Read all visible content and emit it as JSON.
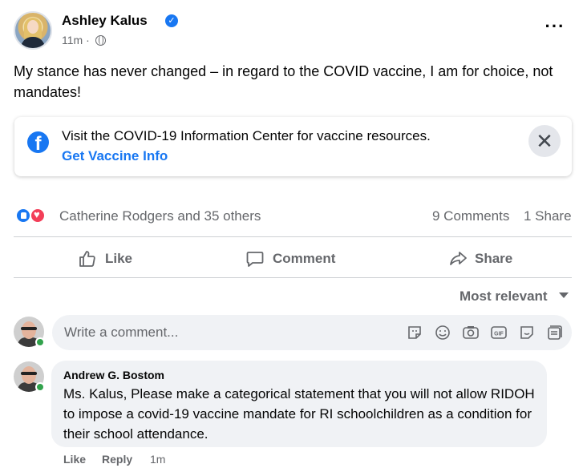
{
  "post": {
    "author": "Ashley Kalus",
    "time": "11m ·",
    "text": "My stance has never changed – in regard to the COVID vaccine, I am for choice, not mandates!"
  },
  "info_card": {
    "text": "Visit the COVID-19 Information Center for vaccine resources.",
    "link": "Get Vaccine Info",
    "close_symbol": "✕"
  },
  "stats": {
    "reactions": "Catherine Rodgers and 35 others",
    "comments": "9 Comments",
    "shares": "1 Share"
  },
  "actions": {
    "like": "Like",
    "comment": "Comment",
    "share": "Share"
  },
  "comments_sort": "Most relevant",
  "comment_input": {
    "placeholder": "Write a comment..."
  },
  "comment": {
    "author": "Andrew G. Bostom",
    "text": "Ms. Kalus, Please make a categorical statement that you will not allow RIDOH to impose a covid-19 vaccine mandate for RI schoolchildren as a condition for their school attendance.",
    "like": "Like",
    "reply": "Reply",
    "time": "1m"
  },
  "colors": {
    "accent": "#1877f2",
    "secondary_text": "#65676b",
    "love": "#f33e58",
    "online": "#31a24c"
  },
  "icons": [
    "verified-icon",
    "globe-icon",
    "more-icon",
    "facebook-icon",
    "close-icon",
    "like-icon",
    "comment-icon",
    "share-icon",
    "caret-down-icon",
    "sticker-icon",
    "emoji-icon",
    "camera-icon",
    "gif-icon",
    "avatar-sticker-icon",
    "sticker-pack-icon"
  ]
}
